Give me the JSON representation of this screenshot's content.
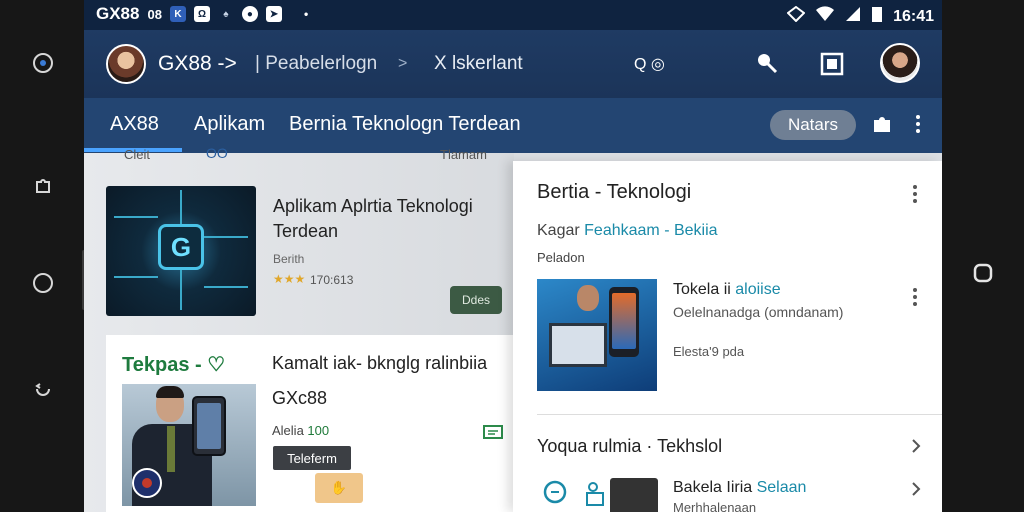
{
  "status": {
    "carrier": "GX88",
    "carrier_extra": "08",
    "time": "16:41"
  },
  "appbar": {
    "title": "GX88",
    "arrow": "->",
    "crumb": "| Peabelerlogn",
    "sep": ">",
    "sub": "X lskerlant",
    "search_text": "Q ◎"
  },
  "tabs": {
    "items": [
      "AX88",
      "Aplikam",
      "Bernia Teknologn Terdean"
    ],
    "pill": "Natars"
  },
  "left_header": {
    "a": "Cleit",
    "b": "OO",
    "c": "Tlamam"
  },
  "card1": {
    "title": "Aplikam Aplrtia Teknologi Terdean",
    "sub": "Berith",
    "stars": "★★★",
    "count": "170:613",
    "button": "Ddes"
  },
  "card2": {
    "brand": "Tekpas -",
    "title": "Kamalt iak- bknglg ralinbiia",
    "sub": "GXc88",
    "meta_prefix": "Alelia",
    "meta_hl": "100",
    "tag": "Teleferm"
  },
  "right": {
    "title": "Bertia - Teknologi",
    "sub_prefix": "Kagar",
    "sub_hl": "Feahkaam - Bekiia",
    "label": "Peladon",
    "item_title_prefix": "Tokela ii",
    "item_title_hl": "aloiise",
    "item_sub": "Oelelnanadga (omndanam)",
    "item_meta": "Elesta'9 pda",
    "row1": "Yoqua rulmia · Tekhslol",
    "row2_title_prefix": "Bakela Iiria",
    "row2_title_hl": "Selaan",
    "row2_sub": "Merhhalenaan"
  }
}
